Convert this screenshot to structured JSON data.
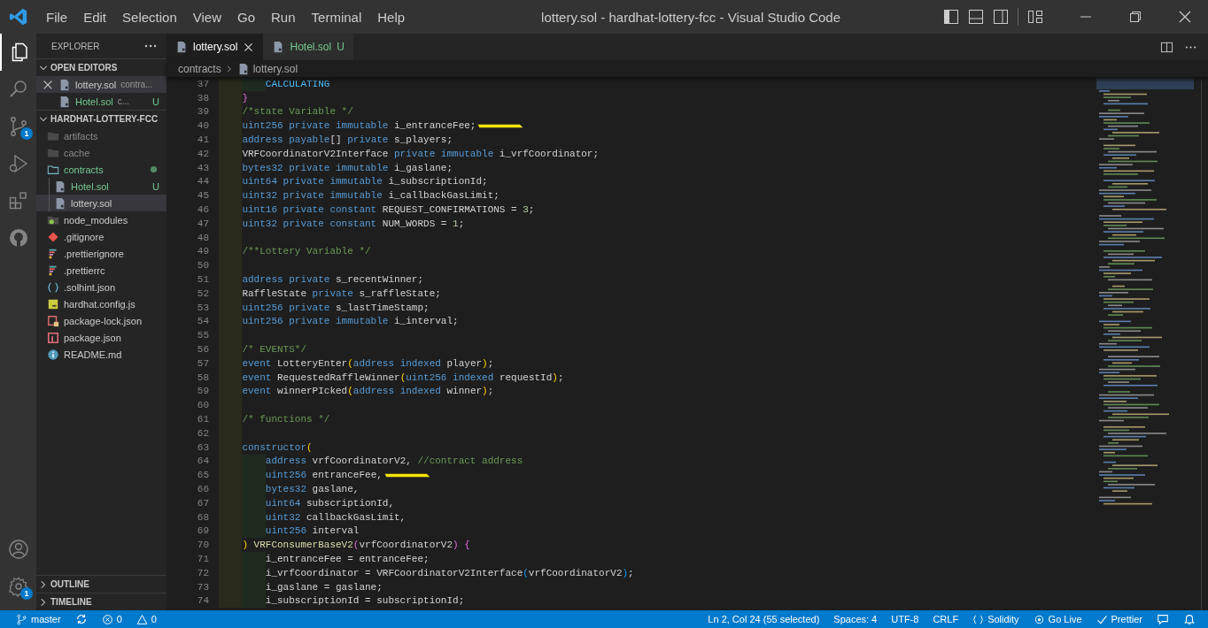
{
  "window": {
    "title": "lottery.sol - hardhat-lottery-fcc - Visual Studio Code"
  },
  "menu": [
    "File",
    "Edit",
    "Selection",
    "View",
    "Go",
    "Run",
    "Terminal",
    "Help"
  ],
  "activity_bar": {
    "items": [
      {
        "kind": "explorer",
        "selected": true
      },
      {
        "kind": "search",
        "selected": false
      },
      {
        "kind": "source-control",
        "selected": false,
        "badge": "1"
      },
      {
        "kind": "run-debug",
        "selected": false
      },
      {
        "kind": "extensions",
        "selected": false
      },
      {
        "kind": "github",
        "selected": false
      }
    ],
    "bottom": [
      {
        "kind": "account"
      },
      {
        "kind": "settings",
        "badge": "1"
      }
    ]
  },
  "sidebar": {
    "title": "EXPLORER",
    "sections": [
      {
        "title": "OPEN EDITORS",
        "expanded": true,
        "kind": "editors",
        "items": [
          {
            "name": "lottery.sol",
            "description": "contra...",
            "kind": "sol",
            "selected": true,
            "untracked": false
          },
          {
            "name": "Hotel.sol",
            "description": "c...",
            "kind": "sol",
            "selected": false,
            "untracked": true,
            "badge": "U"
          }
        ]
      },
      {
        "title": "HARDHAT-LOTTERY-FCC",
        "expanded": true,
        "kind": "tree",
        "items": [
          {
            "name": "artifacts",
            "kind": "folder",
            "expanded": false,
            "ignored": true,
            "selected": false,
            "untracked": false,
            "changed": false
          },
          {
            "name": "cache",
            "kind": "folder",
            "expanded": false,
            "ignored": true,
            "selected": false,
            "untracked": false,
            "changed": false
          },
          {
            "name": "contracts",
            "kind": "folder",
            "expanded": true,
            "ignored": false,
            "selected": false,
            "untracked": false,
            "changed": true,
            "children": [
              {
                "name": "Hotel.sol",
                "kind": "sol",
                "ignored": false,
                "selected": false,
                "untracked": true,
                "changed": false,
                "badge": "U"
              },
              {
                "name": "lottery.sol",
                "kind": "sol",
                "ignored": false,
                "selected": true,
                "untracked": false,
                "changed": false
              }
            ]
          },
          {
            "name": "node_modules",
            "kind": "node-folder",
            "expanded": false,
            "ignored": false,
            "selected": false,
            "untracked": false,
            "changed": false
          },
          {
            "name": ".gitignore",
            "kind": "git",
            "ignored": false,
            "selected": false,
            "untracked": false,
            "changed": false
          },
          {
            "name": ".prettierignore",
            "kind": "prettier",
            "ignored": false,
            "selected": false,
            "untracked": false,
            "changed": false
          },
          {
            "name": ".prettierrc",
            "kind": "prettier",
            "ignored": false,
            "selected": false,
            "untracked": false,
            "changed": false
          },
          {
            "name": ".solhint.json",
            "kind": "braces",
            "ignored": false,
            "selected": false,
            "untracked": false,
            "changed": false
          },
          {
            "name": "hardhat.config.js",
            "kind": "js",
            "ignored": false,
            "selected": false,
            "untracked": false,
            "changed": false
          },
          {
            "name": "package-lock.json",
            "kind": "lock",
            "ignored": false,
            "selected": false,
            "untracked": false,
            "changed": false
          },
          {
            "name": "package.json",
            "kind": "npm",
            "ignored": false,
            "selected": false,
            "untracked": false,
            "changed": false
          },
          {
            "name": "README.md",
            "kind": "info",
            "ignored": false,
            "selected": false,
            "untracked": false,
            "changed": false
          }
        ]
      },
      {
        "title": "OUTLINE",
        "expanded": false,
        "kind": "panel"
      },
      {
        "title": "TIMELINE",
        "expanded": false,
        "kind": "panel"
      }
    ]
  },
  "tabs": [
    {
      "label": "lottery.sol",
      "selected": true,
      "untracked": false
    },
    {
      "label": "Hotel.sol",
      "selected": false,
      "untracked": true,
      "badge": "U"
    }
  ],
  "breadcrumb": [
    "contracts",
    "lottery.sol"
  ],
  "editor": {
    "lines": [
      {
        "n": "37",
        "marked": false,
        "tokens": [
          {
            "kind": "enum",
            "text": "        CALCULATING"
          }
        ]
      },
      {
        "n": "38",
        "marked": false,
        "tokens": [
          {
            "kind": "bracket2",
            "text": "    }"
          }
        ]
      },
      {
        "n": "39",
        "marked": false,
        "tokens": [
          {
            "kind": "comment",
            "text": "    /*state Variable */"
          }
        ]
      },
      {
        "n": "40",
        "marked": true,
        "tokens": [
          {
            "kind": "keyword",
            "text": "    uint256 private immutable"
          },
          {
            "kind": "plain",
            "text": " i_entranceFee;"
          }
        ]
      },
      {
        "n": "41",
        "marked": false,
        "tokens": [
          {
            "kind": "keyword",
            "text": "    address payable"
          },
          {
            "kind": "plain",
            "text": "[]"
          },
          {
            "kind": "keyword",
            "text": " private"
          },
          {
            "kind": "plain",
            "text": " s_players;"
          }
        ]
      },
      {
        "n": "42",
        "marked": false,
        "tokens": [
          {
            "kind": "plain",
            "text": "    VRFCoordinatorV2Interface"
          },
          {
            "kind": "keyword",
            "text": " private immutable"
          },
          {
            "kind": "plain",
            "text": " i_vrfCoordinator;"
          }
        ]
      },
      {
        "n": "43",
        "marked": false,
        "tokens": [
          {
            "kind": "keyword",
            "text": "    bytes32 private immutable"
          },
          {
            "kind": "plain",
            "text": " i_gaslane;"
          }
        ]
      },
      {
        "n": "44",
        "marked": false,
        "tokens": [
          {
            "kind": "keyword",
            "text": "    uint64 private immutable"
          },
          {
            "kind": "plain",
            "text": " i_subscriptionId;"
          }
        ]
      },
      {
        "n": "45",
        "marked": false,
        "tokens": [
          {
            "kind": "keyword",
            "text": "    uint32 private immutable"
          },
          {
            "kind": "plain",
            "text": " i_callbackGasLimit;"
          }
        ]
      },
      {
        "n": "46",
        "marked": false,
        "tokens": [
          {
            "kind": "keyword",
            "text": "    uint16 private constant"
          },
          {
            "kind": "plain",
            "text": " REQUEST_CONFIRMATIONS = "
          },
          {
            "kind": "number",
            "text": "3"
          },
          {
            "kind": "plain",
            "text": ";"
          }
        ]
      },
      {
        "n": "47",
        "marked": false,
        "tokens": [
          {
            "kind": "keyword",
            "text": "    uint32 private constant"
          },
          {
            "kind": "plain",
            "text": " NUM_WORDS = "
          },
          {
            "kind": "number",
            "text": "1"
          },
          {
            "kind": "plain",
            "text": ";"
          }
        ]
      },
      {
        "n": "48",
        "marked": false
      },
      {
        "n": "49",
        "marked": false,
        "tokens": [
          {
            "kind": "comment",
            "text": "    /**Lottery Variable */"
          }
        ]
      },
      {
        "n": "50",
        "marked": false
      },
      {
        "n": "51",
        "marked": false,
        "tokens": [
          {
            "kind": "keyword",
            "text": "    address private"
          },
          {
            "kind": "plain",
            "text": " s_recentWinner;"
          }
        ]
      },
      {
        "n": "52",
        "marked": false,
        "tokens": [
          {
            "kind": "plain",
            "text": "    RaffleState"
          },
          {
            "kind": "keyword",
            "text": " private"
          },
          {
            "kind": "plain",
            "text": " s_raffleState;"
          }
        ]
      },
      {
        "n": "53",
        "marked": false,
        "tokens": [
          {
            "kind": "keyword",
            "text": "    uint256 private"
          },
          {
            "kind": "plain",
            "text": " s_lastTimeStamp;"
          }
        ]
      },
      {
        "n": "54",
        "marked": false,
        "tokens": [
          {
            "kind": "keyword",
            "text": "    uint256 private immutable"
          },
          {
            "kind": "plain",
            "text": " i_interval;"
          }
        ]
      },
      {
        "n": "55",
        "marked": false
      },
      {
        "n": "56",
        "marked": false,
        "tokens": [
          {
            "kind": "comment",
            "text": "    /* EVENTS*/"
          }
        ]
      },
      {
        "n": "57",
        "marked": false,
        "tokens": [
          {
            "kind": "keyword",
            "text": "    event"
          },
          {
            "kind": "plain",
            "text": " LotteryEnter"
          },
          {
            "kind": "bracket1",
            "text": "("
          },
          {
            "kind": "keyword",
            "text": "address indexed"
          },
          {
            "kind": "plain",
            "text": " player"
          },
          {
            "kind": "bracket1",
            "text": ")"
          },
          {
            "kind": "plain",
            "text": ";"
          }
        ]
      },
      {
        "n": "58",
        "marked": false,
        "tokens": [
          {
            "kind": "keyword",
            "text": "    event"
          },
          {
            "kind": "plain",
            "text": " RequestedRaffleWinner"
          },
          {
            "kind": "bracket1",
            "text": "("
          },
          {
            "kind": "keyword",
            "text": "uint256 indexed"
          },
          {
            "kind": "plain",
            "text": " requestId"
          },
          {
            "kind": "bracket1",
            "text": ")"
          },
          {
            "kind": "plain",
            "text": ";"
          }
        ]
      },
      {
        "n": "59",
        "marked": false,
        "tokens": [
          {
            "kind": "keyword",
            "text": "    event"
          },
          {
            "kind": "plain",
            "text": " winnerPIcked"
          },
          {
            "kind": "bracket1",
            "text": "("
          },
          {
            "kind": "keyword",
            "text": "address indexed"
          },
          {
            "kind": "plain",
            "text": " winner"
          },
          {
            "kind": "bracket1",
            "text": ")"
          },
          {
            "kind": "plain",
            "text": ";"
          }
        ]
      },
      {
        "n": "60",
        "marked": false
      },
      {
        "n": "61",
        "marked": false,
        "tokens": [
          {
            "kind": "comment",
            "text": "    /* functions */"
          }
        ]
      },
      {
        "n": "62",
        "marked": false
      },
      {
        "n": "63",
        "marked": false,
        "tokens": [
          {
            "kind": "keyword",
            "text": "    constructor"
          },
          {
            "kind": "bracket1",
            "text": "("
          }
        ]
      },
      {
        "n": "64",
        "marked": false,
        "tokens": [
          {
            "kind": "keyword",
            "text": "        address"
          },
          {
            "kind": "plain",
            "text": " vrfCoordinatorV2, "
          },
          {
            "kind": "comment",
            "text": "//contract address"
          }
        ]
      },
      {
        "n": "65",
        "marked": true,
        "tokens": [
          {
            "kind": "keyword",
            "text": "        uint256"
          },
          {
            "kind": "plain",
            "text": " entranceFee,"
          }
        ]
      },
      {
        "n": "66",
        "marked": false,
        "tokens": [
          {
            "kind": "keyword",
            "text": "        bytes32"
          },
          {
            "kind": "plain",
            "text": " gaslane,"
          }
        ]
      },
      {
        "n": "67",
        "marked": false,
        "tokens": [
          {
            "kind": "keyword",
            "text": "        uint64"
          },
          {
            "kind": "plain",
            "text": " subscriptionId,"
          }
        ]
      },
      {
        "n": "68",
        "marked": false,
        "tokens": [
          {
            "kind": "keyword",
            "text": "        uint32"
          },
          {
            "kind": "plain",
            "text": " callbackGasLimit,"
          }
        ]
      },
      {
        "n": "69",
        "marked": false,
        "tokens": [
          {
            "kind": "keyword",
            "text": "        uint256"
          },
          {
            "kind": "plain",
            "text": " interval"
          }
        ]
      },
      {
        "n": "70",
        "marked": false,
        "tokens": [
          {
            "kind": "bracket1",
            "text": "    )"
          },
          {
            "kind": "function",
            "text": " VRFConsumerBaseV2"
          },
          {
            "kind": "bracket2",
            "text": "("
          },
          {
            "kind": "plain",
            "text": "vrfCoordinatorV2"
          },
          {
            "kind": "bracket2",
            "text": ") {"
          }
        ]
      },
      {
        "n": "71",
        "marked": false,
        "tokens": [
          {
            "kind": "plain",
            "text": "        i_entranceFee = entranceFee;"
          }
        ]
      },
      {
        "n": "72",
        "marked": false,
        "tokens": [
          {
            "kind": "plain",
            "text": "        i_vrfCoordinator = VRFCoordinatorV2Interface"
          },
          {
            "kind": "bracket3",
            "text": "("
          },
          {
            "kind": "plain",
            "text": "vrfCoordinatorV2"
          },
          {
            "kind": "bracket3",
            "text": ")"
          },
          {
            "kind": "plain",
            "text": ";"
          }
        ]
      },
      {
        "n": "73",
        "marked": false,
        "tokens": [
          {
            "kind": "plain",
            "text": "        i_gaslane = gaslane;"
          }
        ]
      },
      {
        "n": "74",
        "marked": false,
        "tokens": [
          {
            "kind": "plain",
            "text": "        i_subscriptionId = subscriptionId;"
          }
        ]
      }
    ]
  },
  "status_bar": {
    "left": [
      {
        "kind": "branch",
        "text": "master"
      },
      {
        "kind": "sync"
      },
      {
        "kind": "errors",
        "text": "0"
      },
      {
        "kind": "warnings",
        "text": "0"
      }
    ],
    "right": [
      {
        "kind": "text",
        "text": "Ln 2, Col 24 (55 selected)"
      },
      {
        "kind": "text",
        "text": "Spaces: 4"
      },
      {
        "kind": "text",
        "text": "UTF-8"
      },
      {
        "kind": "text",
        "text": "CRLF"
      },
      {
        "kind": "language",
        "text": "Solidity"
      },
      {
        "kind": "go-live",
        "text": "Go Live"
      },
      {
        "kind": "prettier",
        "text": "Prettier"
      },
      {
        "kind": "feedback"
      },
      {
        "kind": "bell"
      }
    ]
  }
}
